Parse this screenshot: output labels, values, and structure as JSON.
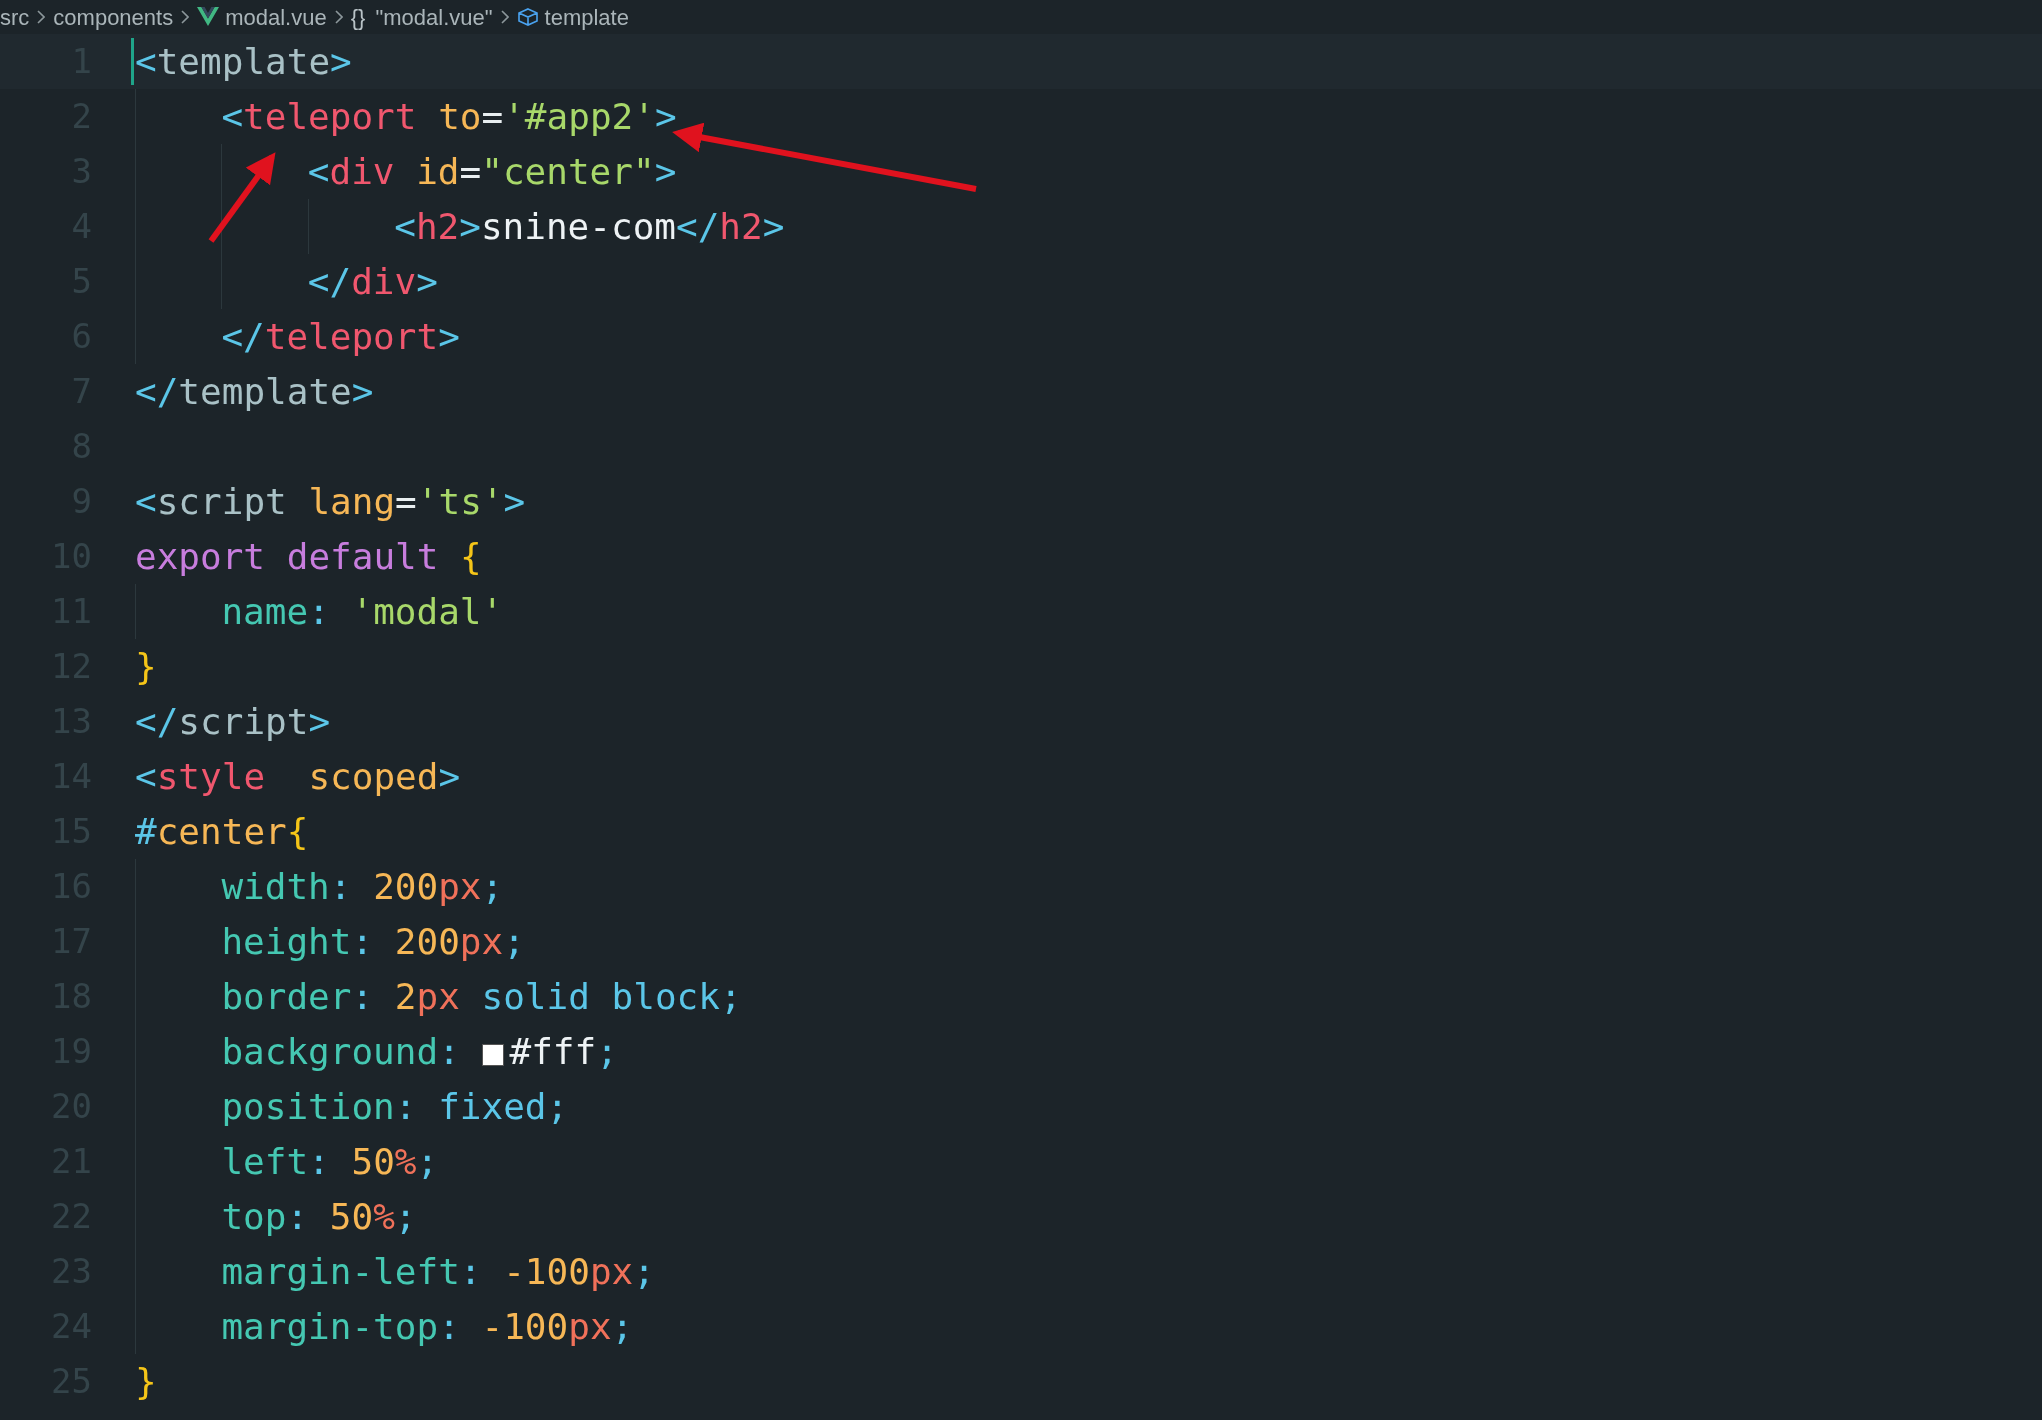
{
  "breadcrumb": [
    {
      "kind": "folder",
      "label": "src"
    },
    {
      "kind": "folder",
      "label": "components"
    },
    {
      "kind": "vue-file",
      "label": "modal.vue"
    },
    {
      "kind": "object",
      "symbol": "{}",
      "label": "\"modal.vue\""
    },
    {
      "kind": "element",
      "label": "template"
    }
  ],
  "lines": [
    {
      "number": "1",
      "selected": true,
      "tokens": [
        {
          "kind": "bracket",
          "text": "<"
        },
        {
          "kind": "tag-plain",
          "text": "template"
        },
        {
          "kind": "bracket",
          "text": ">"
        }
      ]
    },
    {
      "number": "2",
      "selected": false,
      "tokens": [
        {
          "kind": "bracket",
          "text": "    <"
        },
        {
          "kind": "tag",
          "text": "teleport"
        },
        {
          "kind": "attr",
          "text": " to"
        },
        {
          "kind": "op",
          "text": "="
        },
        {
          "kind": "string",
          "text": "'#app2'"
        },
        {
          "kind": "bracket",
          "text": ">"
        }
      ]
    },
    {
      "number": "3",
      "selected": false,
      "tokens": [
        {
          "kind": "bracket",
          "text": "        <"
        },
        {
          "kind": "tag",
          "text": "div"
        },
        {
          "kind": "attr",
          "text": " id"
        },
        {
          "kind": "op",
          "text": "="
        },
        {
          "kind": "string",
          "text": "\"center\""
        },
        {
          "kind": "bracket",
          "text": ">"
        }
      ]
    },
    {
      "number": "4",
      "selected": false,
      "tokens": [
        {
          "kind": "bracket",
          "text": "            <"
        },
        {
          "kind": "tag",
          "text": "h2"
        },
        {
          "kind": "bracket",
          "text": ">"
        },
        {
          "kind": "text",
          "text": "snine-com"
        },
        {
          "kind": "bracket",
          "text": "</"
        },
        {
          "kind": "tag",
          "text": "h2"
        },
        {
          "kind": "bracket",
          "text": ">"
        }
      ]
    },
    {
      "number": "5",
      "selected": false,
      "tokens": [
        {
          "kind": "bracket",
          "text": "        </"
        },
        {
          "kind": "tag",
          "text": "div"
        },
        {
          "kind": "bracket",
          "text": ">"
        }
      ]
    },
    {
      "number": "6",
      "selected": false,
      "tokens": [
        {
          "kind": "bracket",
          "text": "    </"
        },
        {
          "kind": "tag",
          "text": "teleport"
        },
        {
          "kind": "bracket",
          "text": ">"
        }
      ]
    },
    {
      "number": "7",
      "selected": false,
      "tokens": [
        {
          "kind": "bracket",
          "text": "</"
        },
        {
          "kind": "tag-plain",
          "text": "template"
        },
        {
          "kind": "bracket",
          "text": ">"
        }
      ]
    },
    {
      "number": "8",
      "selected": false
    },
    {
      "number": "9",
      "selected": false,
      "tokens": [
        {
          "kind": "bracket",
          "text": "<"
        },
        {
          "kind": "tag-plain",
          "text": "script"
        },
        {
          "kind": "attr",
          "text": " lang"
        },
        {
          "kind": "op",
          "text": "="
        },
        {
          "kind": "string",
          "text": "'ts'"
        },
        {
          "kind": "bracket",
          "text": ">"
        }
      ]
    },
    {
      "number": "10",
      "selected": false,
      "tokens": [
        {
          "kind": "keyword",
          "text": "export default"
        },
        {
          "kind": "brace",
          "text": " {"
        }
      ]
    },
    {
      "number": "11",
      "selected": false,
      "tokens": [
        {
          "kind": "prop",
          "text": "    name"
        },
        {
          "kind": "punct",
          "text": ":"
        },
        {
          "kind": "string",
          "text": " 'modal'"
        }
      ]
    },
    {
      "number": "12",
      "selected": false,
      "tokens": [
        {
          "kind": "brace",
          "text": "}"
        }
      ]
    },
    {
      "number": "13",
      "selected": false,
      "tokens": [
        {
          "kind": "bracket",
          "text": "</"
        },
        {
          "kind": "tag-plain",
          "text": "script"
        },
        {
          "kind": "bracket",
          "text": ">"
        }
      ]
    },
    {
      "number": "14",
      "selected": false,
      "tokens": [
        {
          "kind": "bracket",
          "text": "<"
        },
        {
          "kind": "tag",
          "text": "style"
        },
        {
          "kind": "attr",
          "text": "  scoped"
        },
        {
          "kind": "bracket",
          "text": ">"
        }
      ]
    },
    {
      "number": "15",
      "selected": false,
      "tokens": [
        {
          "kind": "punct",
          "text": "#"
        },
        {
          "kind": "attr",
          "text": "center"
        },
        {
          "kind": "brace",
          "text": "{"
        }
      ]
    },
    {
      "number": "16",
      "selected": false,
      "tokens": [
        {
          "kind": "prop",
          "text": "    width"
        },
        {
          "kind": "punct",
          "text": ":"
        },
        {
          "kind": "number",
          "text": " 200"
        },
        {
          "kind": "unit",
          "text": "px"
        },
        {
          "kind": "punct",
          "text": ";"
        }
      ]
    },
    {
      "number": "17",
      "selected": false,
      "tokens": [
        {
          "kind": "prop",
          "text": "    height"
        },
        {
          "kind": "punct",
          "text": ":"
        },
        {
          "kind": "number",
          "text": " 200"
        },
        {
          "kind": "unit",
          "text": "px"
        },
        {
          "kind": "punct",
          "text": ";"
        }
      ]
    },
    {
      "number": "18",
      "selected": false,
      "tokens": [
        {
          "kind": "prop",
          "text": "    border"
        },
        {
          "kind": "punct",
          "text": ":"
        },
        {
          "kind": "number",
          "text": " 2"
        },
        {
          "kind": "unit",
          "text": "px"
        },
        {
          "kind": "value",
          "text": " solid block"
        },
        {
          "kind": "punct",
          "text": ";"
        }
      ]
    },
    {
      "number": "19",
      "selected": false,
      "tokens": [
        {
          "kind": "prop",
          "text": "    background"
        },
        {
          "kind": "punct",
          "text": ": "
        },
        {
          "kind": "swatch"
        },
        {
          "kind": "text",
          "text": "#fff"
        },
        {
          "kind": "punct",
          "text": ";"
        }
      ]
    },
    {
      "number": "20",
      "selected": false,
      "tokens": [
        {
          "kind": "prop",
          "text": "    position"
        },
        {
          "kind": "punct",
          "text": ":"
        },
        {
          "kind": "value",
          "text": " fixed"
        },
        {
          "kind": "punct",
          "text": ";"
        }
      ]
    },
    {
      "number": "21",
      "selected": false,
      "tokens": [
        {
          "kind": "prop",
          "text": "    left"
        },
        {
          "kind": "punct",
          "text": ":"
        },
        {
          "kind": "number",
          "text": " 50"
        },
        {
          "kind": "unit",
          "text": "%"
        },
        {
          "kind": "punct",
          "text": ";"
        }
      ]
    },
    {
      "number": "22",
      "selected": false,
      "tokens": [
        {
          "kind": "prop",
          "text": "    top"
        },
        {
          "kind": "punct",
          "text": ":"
        },
        {
          "kind": "number",
          "text": " 50"
        },
        {
          "kind": "unit",
          "text": "%"
        },
        {
          "kind": "punct",
          "text": ";"
        }
      ]
    },
    {
      "number": "23",
      "selected": false,
      "tokens": [
        {
          "kind": "prop",
          "text": "    margin-left"
        },
        {
          "kind": "punct",
          "text": ":"
        },
        {
          "kind": "number",
          "text": " -100"
        },
        {
          "kind": "unit",
          "text": "px"
        },
        {
          "kind": "punct",
          "text": ";"
        }
      ]
    },
    {
      "number": "24",
      "selected": false,
      "tokens": [
        {
          "kind": "prop",
          "text": "    margin-top"
        },
        {
          "kind": "punct",
          "text": ":"
        },
        {
          "kind": "number",
          "text": " -100"
        },
        {
          "kind": "unit",
          "text": "px"
        },
        {
          "kind": "punct",
          "text": ";"
        }
      ]
    },
    {
      "number": "25",
      "selected": false,
      "tokens": [
        {
          "kind": "brace",
          "text": "}"
        }
      ]
    }
  ]
}
